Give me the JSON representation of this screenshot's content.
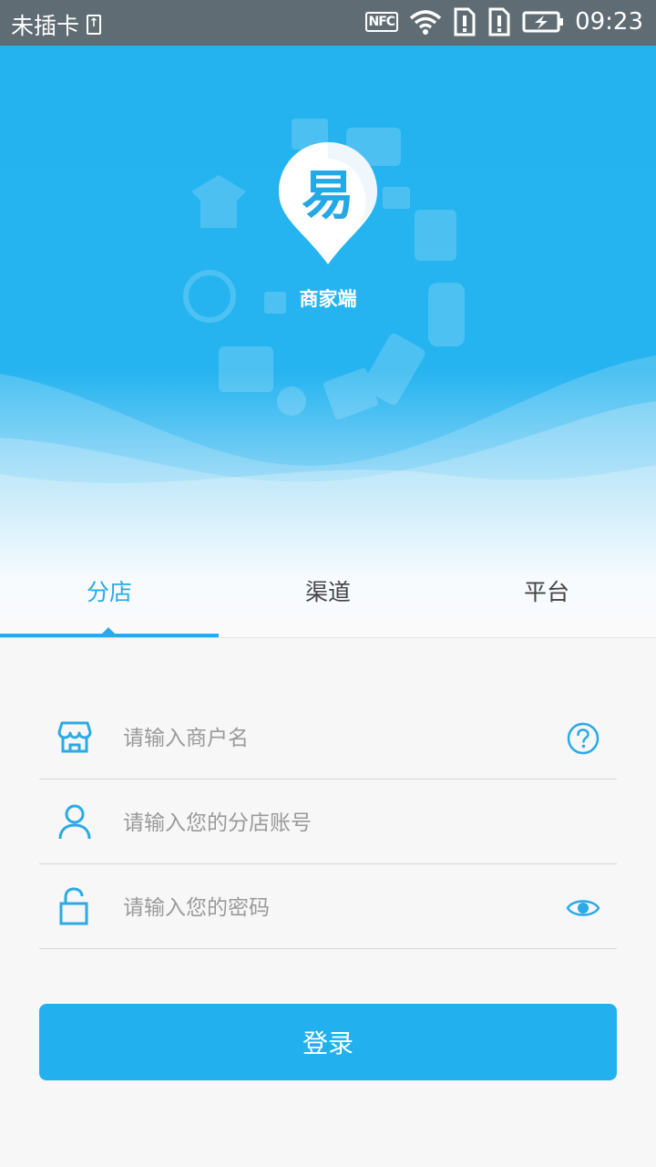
{
  "status_bar": {
    "carrier": "未插卡",
    "nfc": "NFC",
    "time": "09:23",
    "icons": [
      "sim-icon",
      "nfc-icon",
      "wifi-icon",
      "sim-alert-icon",
      "sim-alert-icon",
      "battery-charging-icon"
    ]
  },
  "app": {
    "logo_char": "易",
    "logo_subtitle": "商家端"
  },
  "tabs": [
    {
      "label": "分店",
      "active": true
    },
    {
      "label": "渠道",
      "active": false
    },
    {
      "label": "平台",
      "active": false
    }
  ],
  "form": {
    "merchant": {
      "placeholder": "请输入商户名",
      "value": "",
      "icon": "store-icon",
      "trail_icon": "help-icon"
    },
    "account": {
      "placeholder": "请输入您的分店账号",
      "value": "",
      "icon": "user-icon"
    },
    "password": {
      "placeholder": "请输入您的密码",
      "value": "",
      "icon": "lock-icon",
      "trail_icon": "eye-icon"
    },
    "submit_label": "登录"
  },
  "colors": {
    "accent": "#22b1ee",
    "status_bar": "#5f6c73",
    "tab_active": "#2aaae6",
    "placeholder": "#9a9a9a"
  }
}
